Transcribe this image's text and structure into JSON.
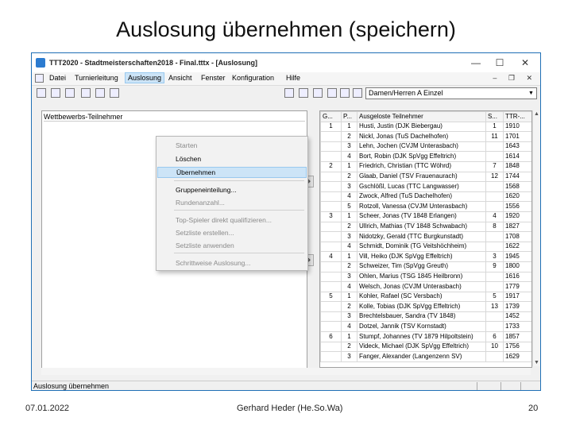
{
  "slide": {
    "title": "Auslosung übernehmen (speichern)",
    "footer_date": "07.01.2022",
    "footer_author": "Gerhard Heder (He.So.Wa)",
    "footer_page": "20"
  },
  "window": {
    "title": "TTT2020 - Stadtmeisterschaften2018 - Final.tttx - [Auslosung]",
    "minimize": "—",
    "maximize": "☐",
    "close": "✕"
  },
  "menu": {
    "items": [
      "Datei",
      "Turnierleitung",
      "Auslosung",
      "Ansicht",
      "Fenster",
      "Konfiguration",
      "Hilfe"
    ],
    "mdi_controls": "– ❐ ✕"
  },
  "toolbar": {
    "combo_value": "Damen/Herren A Einzel"
  },
  "left_panel": {
    "header": "Wettbewerbs-Teilnehmer"
  },
  "dropdown": {
    "items": [
      {
        "label": "Starten",
        "state": "disabled"
      },
      {
        "label": "Löschen",
        "state": "enabled"
      },
      {
        "label": "Übernehmen",
        "state": "selected"
      },
      {
        "label": "Gruppeneinteilung...",
        "state": "enabled"
      },
      {
        "label": "Rundenanzahl...",
        "state": "disabled"
      },
      {
        "label": "Top-Spieler direkt qualifizieren...",
        "state": "disabled"
      },
      {
        "label": "Setzliste erstellen...",
        "state": "disabled"
      },
      {
        "label": "Setzliste anwenden",
        "state": "disabled"
      },
      {
        "label": "Schrittweise Auslosung...",
        "state": "disabled"
      }
    ]
  },
  "grid": {
    "headers": [
      "G...",
      "P...",
      "Ausgeloste Teilnehmer",
      "S...",
      "TTR-..."
    ],
    "rows": [
      [
        "1",
        "1",
        "Husti, Justin (DJK Biebergau)",
        "1",
        "1910"
      ],
      [
        "",
        "2",
        "Nickl, Jonas (TuS Dachelhofen)",
        "11",
        "1701"
      ],
      [
        "",
        "3",
        "Lehn, Jochen (CVJM Unterasbach)",
        "",
        "1643"
      ],
      [
        "",
        "4",
        "Bort, Robin (DJK SpVgg Effeltrich)",
        "",
        "1614"
      ],
      [
        "2",
        "1",
        "Friedrich, Christian (TTC Wöhrd)",
        "7",
        "1848"
      ],
      [
        "",
        "2",
        "Glaab, Daniel (TSV Frauenaurach)",
        "12",
        "1744"
      ],
      [
        "",
        "3",
        "Gschlößl, Lucas (TTC Langwasser)",
        "",
        "1568"
      ],
      [
        "",
        "4",
        "Zwock, Alfred (TuS Dachelhofen)",
        "",
        "1620"
      ],
      [
        "",
        "5",
        "Rotzoll, Vanessa (CVJM Unterasbach)",
        "",
        "1556"
      ],
      [
        "3",
        "1",
        "Scheer, Jonas (TV 1848 Erlangen)",
        "4",
        "1920"
      ],
      [
        "",
        "2",
        "Ullrich, Mathias (TV 1848 Schwabach)",
        "8",
        "1827"
      ],
      [
        "",
        "3",
        "Nidotzky, Gerald (TTC Burgkunstadt)",
        "",
        "1708"
      ],
      [
        "",
        "4",
        "Schmidt, Dominik (TG Veitshöchheim)",
        "",
        "1622"
      ],
      [
        "4",
        "1",
        "Vill, Heiko (DJK SpVgg Effeltrich)",
        "3",
        "1945"
      ],
      [
        "",
        "2",
        "Schweizer, Tim (SpVgg Greuth)",
        "9",
        "1800"
      ],
      [
        "",
        "3",
        "Ohlen, Marius (TSG 1845 Heilbronn)",
        "",
        "1616"
      ],
      [
        "",
        "4",
        "Welsch, Jonas (CVJM Unterasbach)",
        "",
        "1779"
      ],
      [
        "5",
        "1",
        "Kohler, Rafael (SC Versbach)",
        "5",
        "1917"
      ],
      [
        "",
        "2",
        "Kolle, Tobias (DJK SpVgg Effeltrich)",
        "13",
        "1739"
      ],
      [
        "",
        "3",
        "Brechtelsbauer, Sandra (TV 1848)",
        "",
        "1452"
      ],
      [
        "",
        "4",
        "Dotzel, Jannik (TSV Kornstadt)",
        "",
        "1733"
      ],
      [
        "6",
        "1",
        "Stumpf, Johannes (TV 1879 Hilpoltstein)",
        "6",
        "1857"
      ],
      [
        "",
        "2",
        "Videck, Michael (DJK SpVgg Effeltrich)",
        "10",
        "1756"
      ],
      [
        "",
        "3",
        "Fanger, Alexander (Langenzenn SV)",
        "",
        "1629"
      ]
    ]
  },
  "statusbar": {
    "text": "Auslosung übernehmen"
  }
}
